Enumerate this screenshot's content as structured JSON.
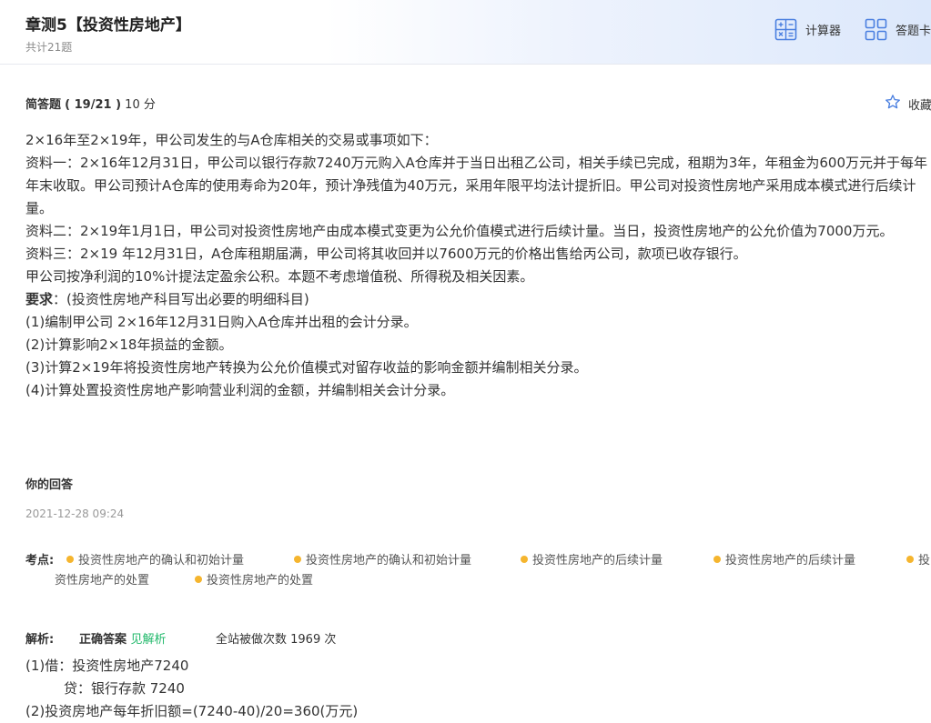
{
  "header": {
    "title": "章测5【投资性房地产】",
    "subtitle": "共计21题",
    "calculator_label": "计算器",
    "answer_card_label": "答题卡"
  },
  "question": {
    "type_label": "简答题",
    "progress": "( 19/21 )",
    "score": "10 分",
    "favorite_label": "收藏",
    "stem": [
      "2×16年至2×19年，甲公司发生的与A仓库相关的交易或事项如下：",
      "资料一：2×16年12月31日，甲公司以银行存款7240万元购入A仓库并于当日出租乙公司，相关手续已完成，租期为3年，年租金为600万元并于每年年末收取。甲公司预计A仓库的使用寿命为20年，预计净残值为40万元，采用年限平均法计提折旧。甲公司对投资性房地产采用成本模式进行后续计量。",
      "资料二：2×19年1月1日，甲公司对投资性房地产由成本模式变更为公允价值模式进行后续计量。当日，投资性房地产的公允价值为7000万元。",
      "资料三：2×19 年12月31日，A仓库租期届满，甲公司将其收回并以7600万元的价格出售给丙公司，款项已收存银行。",
      "甲公司按净利润的10%计提法定盈余公积。本题不考虑增值税、所得税及相关因素。"
    ],
    "requirement_label": "要求",
    "requirement_note": "：(投资性房地产科目写出必要的明细科目)",
    "requirements": [
      "(1)编制甲公司 2×16年12月31日购入A仓库并出租的会计分录。",
      "(2)计算影响2×18年损益的金额。",
      "(3)计算2×19年将投资性房地产转换为公允价值模式对留存收益的影响金额并编制相关分录。",
      "(4)计算处置投资性房地产影响营业利润的金额，并编制相关会计分录。"
    ]
  },
  "answer_section": {
    "title": "你的回答",
    "date": "2021-12-28 09:24"
  },
  "knowledge_points": {
    "label": "考点:",
    "items": [
      "投资性房地产的确认和初始计量",
      "投资性房地产的确认和初始计量",
      "投资性房地产的后续计量",
      "投资性房地产的后续计量",
      "投",
      "资性房地产的处置",
      "投资性房地产的处置"
    ]
  },
  "analysis": {
    "label": "解析:",
    "correct_answer_label": "正确答案",
    "see_analysis": "见解析",
    "count_text": "全站被做次数 1969 次",
    "lines": [
      "(1)借：投资性房地产7240",
      "贷：银行存款   7240",
      "(2)投资房地产每年折旧额=(7240-40)/20=360(万元)"
    ]
  },
  "colors": {
    "accent_blue": "#4a7fe0",
    "dot_orange": "#f5b52e",
    "green": "#20b86a"
  }
}
